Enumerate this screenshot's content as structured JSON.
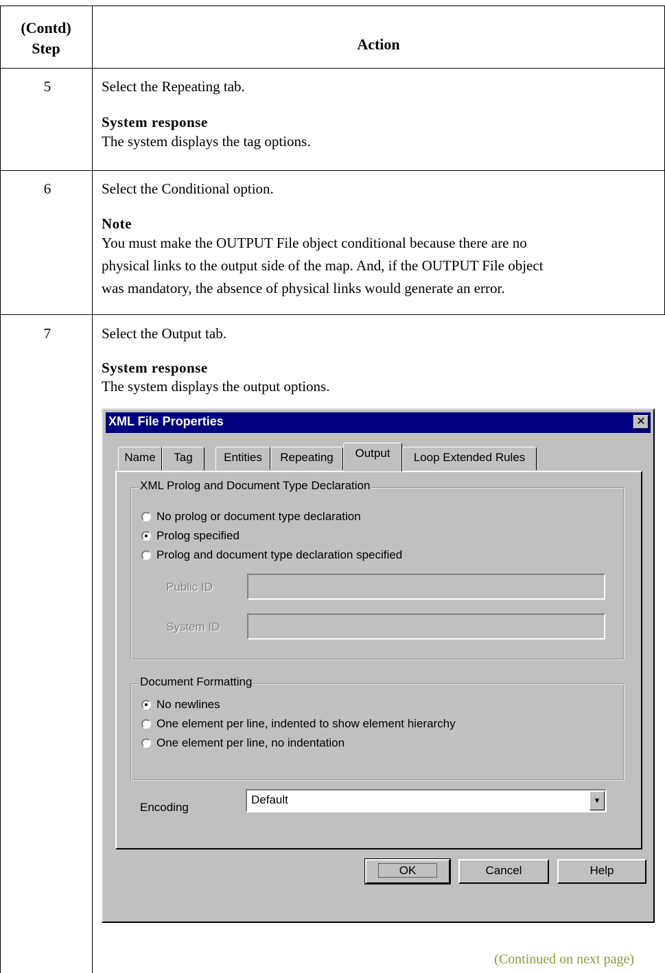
{
  "table": {
    "header": {
      "step_line1": "(Contd)",
      "step_line2": "Step",
      "action": "Action"
    }
  },
  "steps": [
    {
      "number": "5",
      "text": "Select the Repeating tab.",
      "subhead": "System response",
      "body": "The system displays the tag options."
    },
    {
      "number": "6",
      "text": "Select the Conditional option.",
      "subhead": "Note",
      "body_lines": [
        "You must make the OUTPUT File object conditional because there are no",
        "physical links to the output side of the map. And, if the OUTPUT File object",
        "was mandatory, the absence of physical links would generate an error."
      ]
    },
    {
      "number": "7",
      "text": "Select the Output tab.",
      "subhead": "System response",
      "body": "The system displays the output options."
    }
  ],
  "dialog": {
    "title": "XML File Properties",
    "close_icon": "close-icon",
    "tabs": [
      {
        "label": "Name",
        "active": false
      },
      {
        "label": "Tag",
        "active": false
      },
      {
        "label": "Entities",
        "active": false
      },
      {
        "label": "Repeating",
        "active": false
      },
      {
        "label": "Output",
        "active": true
      },
      {
        "label": "Loop Extended Rules",
        "active": false
      }
    ],
    "prolog_group": {
      "legend": "XML Prolog and Document Type Declaration",
      "options": [
        {
          "label": "No prolog or document type declaration",
          "checked": false
        },
        {
          "label": "Prolog specified",
          "checked": true
        },
        {
          "label": "Prolog and document type declaration specified",
          "checked": false
        }
      ],
      "public_id_label": "Public ID",
      "public_id_value": "",
      "system_id_label": "System ID",
      "system_id_value": ""
    },
    "formatting_group": {
      "legend": "Document Formatting",
      "options": [
        {
          "label": "No newlines",
          "checked": true
        },
        {
          "label": "One element per line, indented to show element hierarchy",
          "checked": false
        },
        {
          "label": "One element per line, no indentation",
          "checked": false
        }
      ]
    },
    "encoding": {
      "label": "Encoding",
      "value": "Default"
    },
    "buttons": {
      "ok": "OK",
      "cancel": "Cancel",
      "help": "Help"
    }
  },
  "footer": {
    "continued": "(Continued on next page)"
  }
}
